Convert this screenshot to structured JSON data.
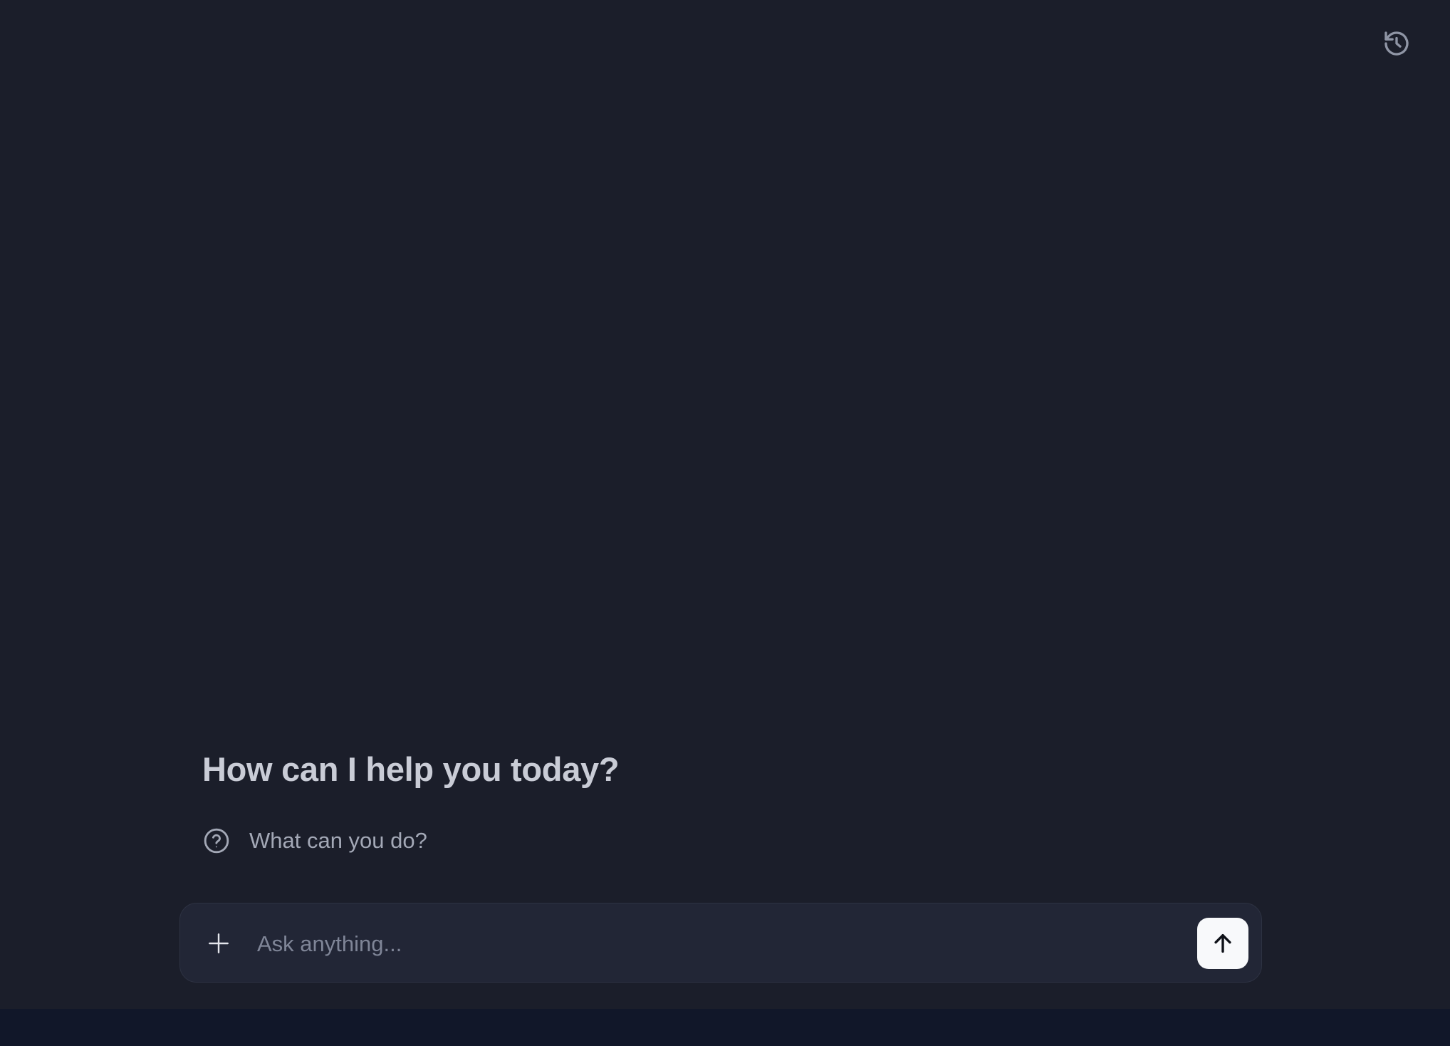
{
  "header": {
    "history_icon": "history-icon"
  },
  "main": {
    "greeting": "How can I help you today?",
    "suggestions": [
      {
        "icon": "question-circle-icon",
        "label": "What can you do?"
      }
    ]
  },
  "composer": {
    "add_icon": "plus-icon",
    "placeholder": "Ask anything...",
    "value": "",
    "send_icon": "arrow-up-icon"
  },
  "colors": {
    "background": "#1b1e2a",
    "footer": "#111729",
    "input_background": "#222636",
    "send_button": "#f8f9fb",
    "heading_text": "#c9ccd6",
    "muted_text": "#a3a8b6"
  }
}
